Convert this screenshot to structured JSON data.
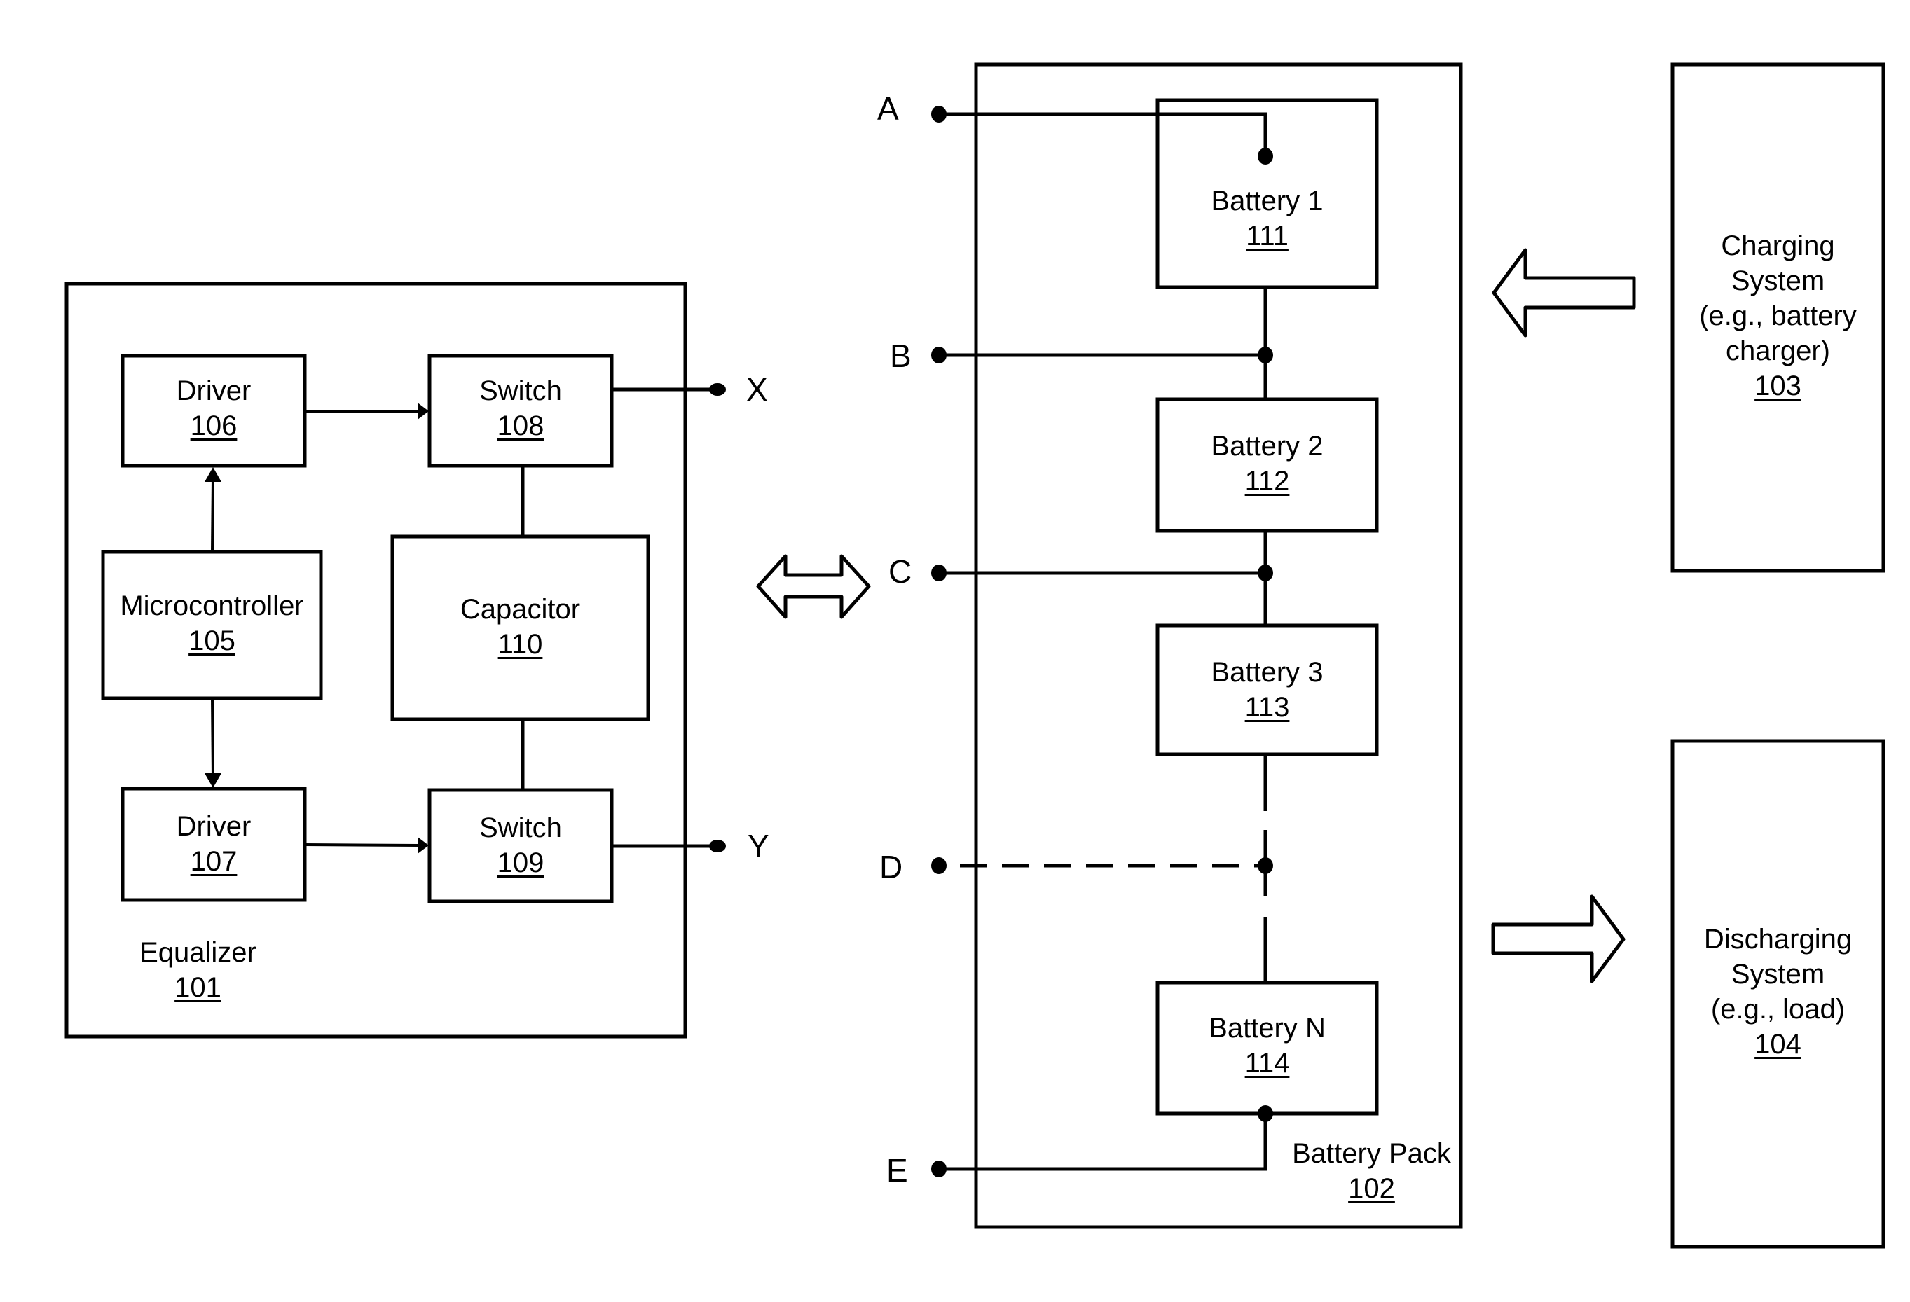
{
  "equalizer": {
    "name": "Equalizer",
    "ref": "101",
    "components": {
      "driver_106": {
        "name": "Driver",
        "ref": "106"
      },
      "switch_108": {
        "name": "Switch",
        "ref": "108"
      },
      "microcontroller_105": {
        "name": "Microcontroller",
        "ref": "105"
      },
      "capacitor_110": {
        "name": "Capacitor",
        "ref": "110"
      },
      "driver_107": {
        "name": "Driver",
        "ref": "107"
      },
      "switch_109": {
        "name": "Switch",
        "ref": "109"
      }
    },
    "terminals": {
      "x": "X",
      "y": "Y"
    }
  },
  "battery_pack": {
    "name": "Battery Pack",
    "ref": "102",
    "terminals": [
      "A",
      "B",
      "C",
      "D",
      "E"
    ],
    "batteries": [
      {
        "name": "Battery 1",
        "ref": "111"
      },
      {
        "name": "Battery 2",
        "ref": "112"
      },
      {
        "name": "Battery 3",
        "ref": "113"
      },
      {
        "name": "Battery N",
        "ref": "114"
      }
    ]
  },
  "charging_system": {
    "lines": [
      "Charging",
      "System",
      "(e.g., battery",
      "charger)"
    ],
    "ref": "103"
  },
  "discharging_system": {
    "lines": [
      "Discharging",
      "System",
      "(e.g., load)"
    ],
    "ref": "104"
  }
}
